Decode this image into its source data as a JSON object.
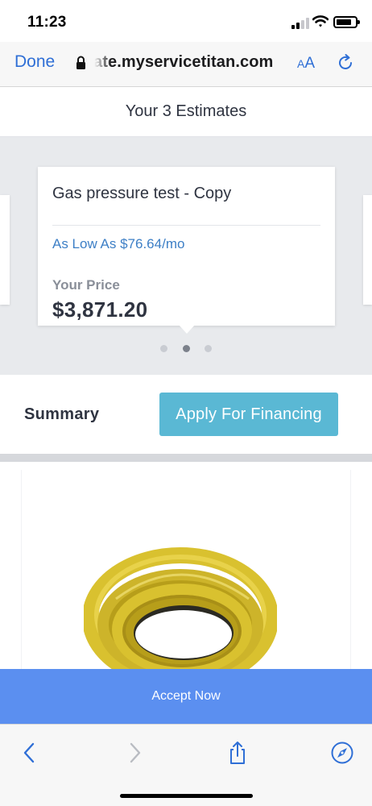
{
  "status_bar": {
    "time": "11:23",
    "icons": [
      "signal-icon",
      "wifi-icon",
      "battery-icon"
    ]
  },
  "browser": {
    "done_label": "Done",
    "url": "ate.myservicetitan.com",
    "text_size_small": "A",
    "text_size_big": "A",
    "icons": [
      "lock-icon",
      "reload-icon"
    ]
  },
  "estimates": {
    "header": "Your 3 Estimates",
    "count": 3,
    "active_index": 1,
    "card": {
      "title": "Gas pressure test - Copy",
      "financing": "As Low As $76.64/mo",
      "price_label": "Your Price",
      "price": "$3,871.20"
    }
  },
  "summary": {
    "label": "Summary",
    "financing_button": "Apply For Financing"
  },
  "product": {
    "image": "gas-hose-coil"
  },
  "accept": {
    "label": "Accept Now"
  },
  "toolbar": {
    "icons": [
      "back-icon",
      "forward-icon",
      "share-icon",
      "compass-icon"
    ]
  },
  "colors": {
    "link_blue": "#2f6fd6",
    "financing_text": "#3d7fc6",
    "financing_button": "#5ab8d4",
    "accept_button": "#5b8ff0",
    "hose_yellow": "#d9c12f"
  }
}
